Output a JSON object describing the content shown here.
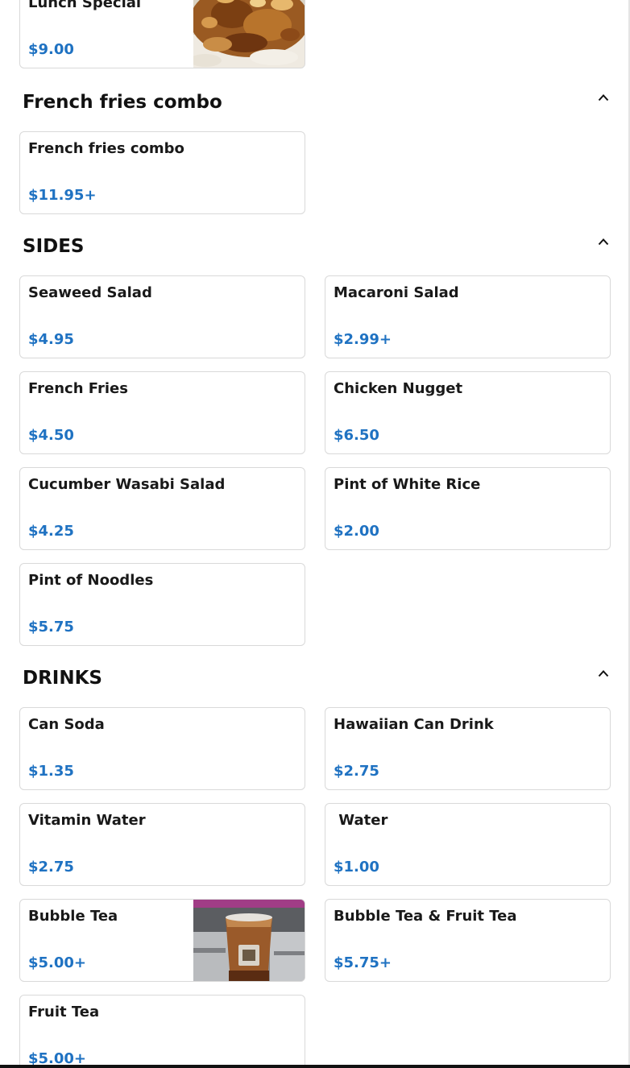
{
  "sections": {
    "lunch": {
      "items": [
        {
          "name": "Lunch Special",
          "price": "$9.00"
        }
      ]
    },
    "french_fries_combo": {
      "title": "French fries combo",
      "items": [
        {
          "name": "French fries combo",
          "price": "$11.95+"
        }
      ]
    },
    "sides": {
      "title": "SIDES",
      "items": [
        {
          "name": "Seaweed Salad",
          "price": "$4.95"
        },
        {
          "name": "Macaroni Salad",
          "price": "$2.99+"
        },
        {
          "name": "French Fries",
          "price": "$4.50"
        },
        {
          "name": "Chicken Nugget",
          "price": "$6.50"
        },
        {
          "name": "Cucumber Wasabi Salad",
          "price": "$4.25"
        },
        {
          "name": "Pint of White Rice",
          "price": "$2.00"
        },
        {
          "name": "Pint of Noodles",
          "price": "$5.75"
        }
      ]
    },
    "drinks": {
      "title": "DRINKS",
      "items": [
        {
          "name": "Can Soda",
          "price": "$1.35"
        },
        {
          "name": "Hawaiian Can Drink",
          "price": "$2.75"
        },
        {
          "name": "Vitamin Water",
          "price": "$2.75"
        },
        {
          "name": " Water",
          "price": "$1.00"
        },
        {
          "name": "Bubble Tea",
          "price": "$5.00+"
        },
        {
          "name": "Bubble Tea & Fruit Tea",
          "price": "$5.75+"
        },
        {
          "name": "Fruit Tea",
          "price": "$5.00+"
        }
      ]
    }
  },
  "icons": {
    "collapse": "chevron-up-icon"
  },
  "colors": {
    "price": "#1f72c2",
    "text": "#191919",
    "card_border": "#d9d9d9"
  }
}
